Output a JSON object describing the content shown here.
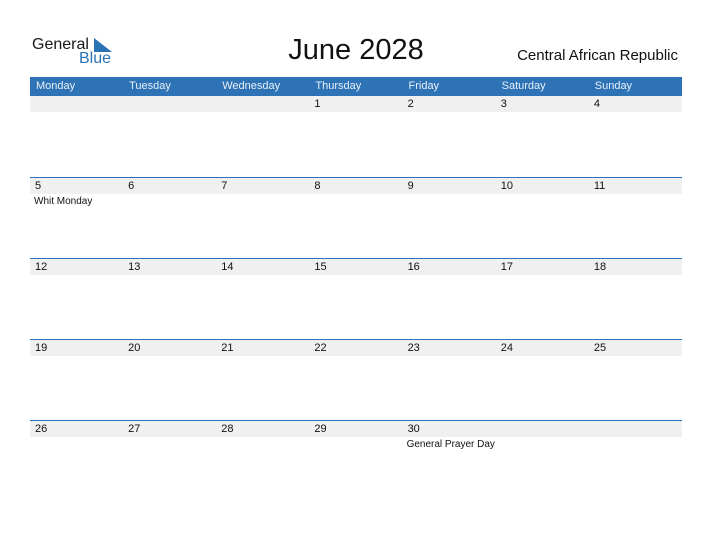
{
  "logo": {
    "word1": "General",
    "word2": "Blue",
    "icon": "triangle-icon"
  },
  "title": "June 2028",
  "country": "Central African Republic",
  "weekdays": [
    "Monday",
    "Tuesday",
    "Wednesday",
    "Thursday",
    "Friday",
    "Saturday",
    "Sunday"
  ],
  "weeks": [
    {
      "days": [
        {
          "num": "",
          "event": ""
        },
        {
          "num": "",
          "event": ""
        },
        {
          "num": "",
          "event": ""
        },
        {
          "num": "1",
          "event": ""
        },
        {
          "num": "2",
          "event": ""
        },
        {
          "num": "3",
          "event": ""
        },
        {
          "num": "4",
          "event": ""
        }
      ]
    },
    {
      "days": [
        {
          "num": "5",
          "event": "Whit Monday"
        },
        {
          "num": "6",
          "event": ""
        },
        {
          "num": "7",
          "event": ""
        },
        {
          "num": "8",
          "event": ""
        },
        {
          "num": "9",
          "event": ""
        },
        {
          "num": "10",
          "event": ""
        },
        {
          "num": "11",
          "event": ""
        }
      ]
    },
    {
      "days": [
        {
          "num": "12",
          "event": ""
        },
        {
          "num": "13",
          "event": ""
        },
        {
          "num": "14",
          "event": ""
        },
        {
          "num": "15",
          "event": ""
        },
        {
          "num": "16",
          "event": ""
        },
        {
          "num": "17",
          "event": ""
        },
        {
          "num": "18",
          "event": ""
        }
      ]
    },
    {
      "days": [
        {
          "num": "19",
          "event": ""
        },
        {
          "num": "20",
          "event": ""
        },
        {
          "num": "21",
          "event": ""
        },
        {
          "num": "22",
          "event": ""
        },
        {
          "num": "23",
          "event": ""
        },
        {
          "num": "24",
          "event": ""
        },
        {
          "num": "25",
          "event": ""
        }
      ]
    },
    {
      "days": [
        {
          "num": "26",
          "event": ""
        },
        {
          "num": "27",
          "event": ""
        },
        {
          "num": "28",
          "event": ""
        },
        {
          "num": "29",
          "event": ""
        },
        {
          "num": "30",
          "event": "General Prayer Day"
        },
        {
          "num": "",
          "event": ""
        },
        {
          "num": "",
          "event": ""
        }
      ]
    }
  ]
}
